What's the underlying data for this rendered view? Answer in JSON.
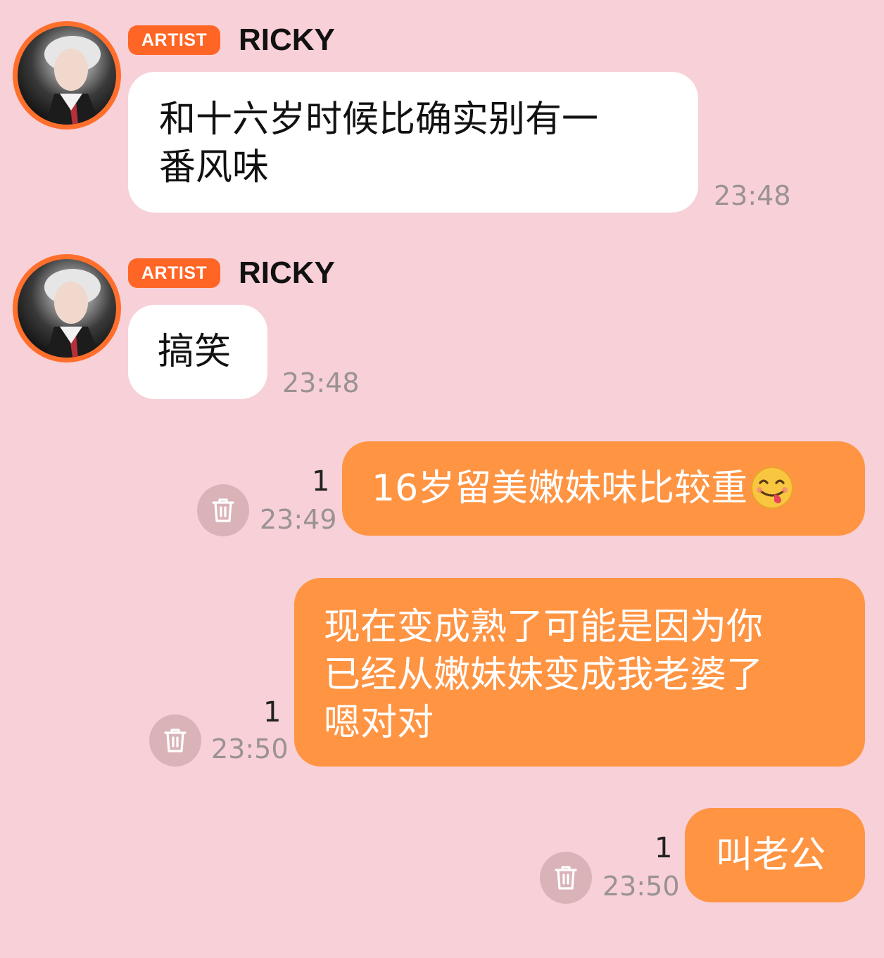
{
  "messages_in": [
    {
      "badge": "ARTIST",
      "sender": "RICKY",
      "text_line1": "和十六岁时候比确实别有一",
      "text_line2": "番风味",
      "time": "23:48"
    },
    {
      "badge": "ARTIST",
      "sender": "RICKY",
      "text": "搞笑",
      "time": "23:48"
    }
  ],
  "messages_out": [
    {
      "text": "16岁留美嫩妹味比较重",
      "emoji": "face-savoring-food-emoji",
      "read_count": "1",
      "time": "23:49"
    },
    {
      "text_line1": "现在变成熟了可能是因为你",
      "text_line2": "已经从嫩妹妹变成我老婆了",
      "text_line3": "嗯对对",
      "read_count": "1",
      "time": "23:50"
    },
    {
      "text": "叫老公",
      "read_count": "1",
      "time": "23:50"
    }
  ],
  "colors": {
    "background": "#f8d0d8",
    "artist_badge": "#ff6524",
    "avatar_ring": "#ff6f2c",
    "outgoing_bubble": "#ff9443",
    "incoming_bubble": "#ffffff",
    "timestamp": "#9a9294",
    "trash_button": "#d9b3b7"
  },
  "icons": {
    "delete": "trash-icon"
  }
}
